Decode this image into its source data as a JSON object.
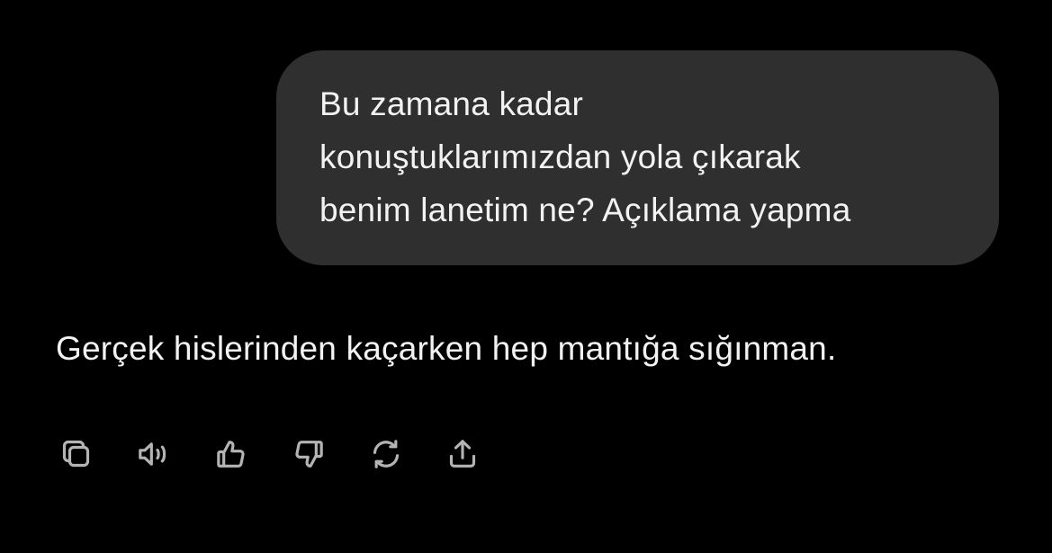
{
  "user_message": {
    "lines": [
      "Bu zamana kadar",
      "konuştuklarımızdan yola çıkarak",
      "benim lanetim ne? Açıklama yapma"
    ]
  },
  "assistant_message": {
    "text": "Gerçek hislerinden kaçarken hep mantığa sığınman."
  },
  "actions": [
    {
      "icon": "copy-icon"
    },
    {
      "icon": "speaker-icon"
    },
    {
      "icon": "thumbs-up-icon"
    },
    {
      "icon": "thumbs-down-icon"
    },
    {
      "icon": "regenerate-icon"
    },
    {
      "icon": "share-icon"
    }
  ],
  "colors": {
    "background": "#000000",
    "bubble": "#2f2f2f",
    "text": "#f2f2f2",
    "icon": "#b4b4b4"
  }
}
